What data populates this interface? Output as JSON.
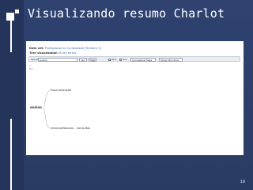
{
  "slide": {
    "title": "Visualizando resumo Charlot",
    "page_number": "19"
  },
  "app": {
    "data_row": {
      "label": "Data set:",
      "value": "Professional se Curiosidade [Tenebra 1]"
    },
    "view_row": {
      "label": "Tree visualization",
      "value": "of key terms"
    },
    "toolbar": {
      "search_label": "Search",
      "search_value": "ensino",
      "go_button": "Go",
      "help_button": "Help",
      "radio_1_label": "Text",
      "radio_2_label": "Tool",
      "select_1": "Conceptual flags",
      "select_2": "Show Structure"
    },
    "tiny_top": "1",
    "tiny_top2": "Em",
    "tree": {
      "root": "ensino",
      "child_top": "Especialização",
      "child_bottom": "Interprofissional - Consultas"
    }
  }
}
